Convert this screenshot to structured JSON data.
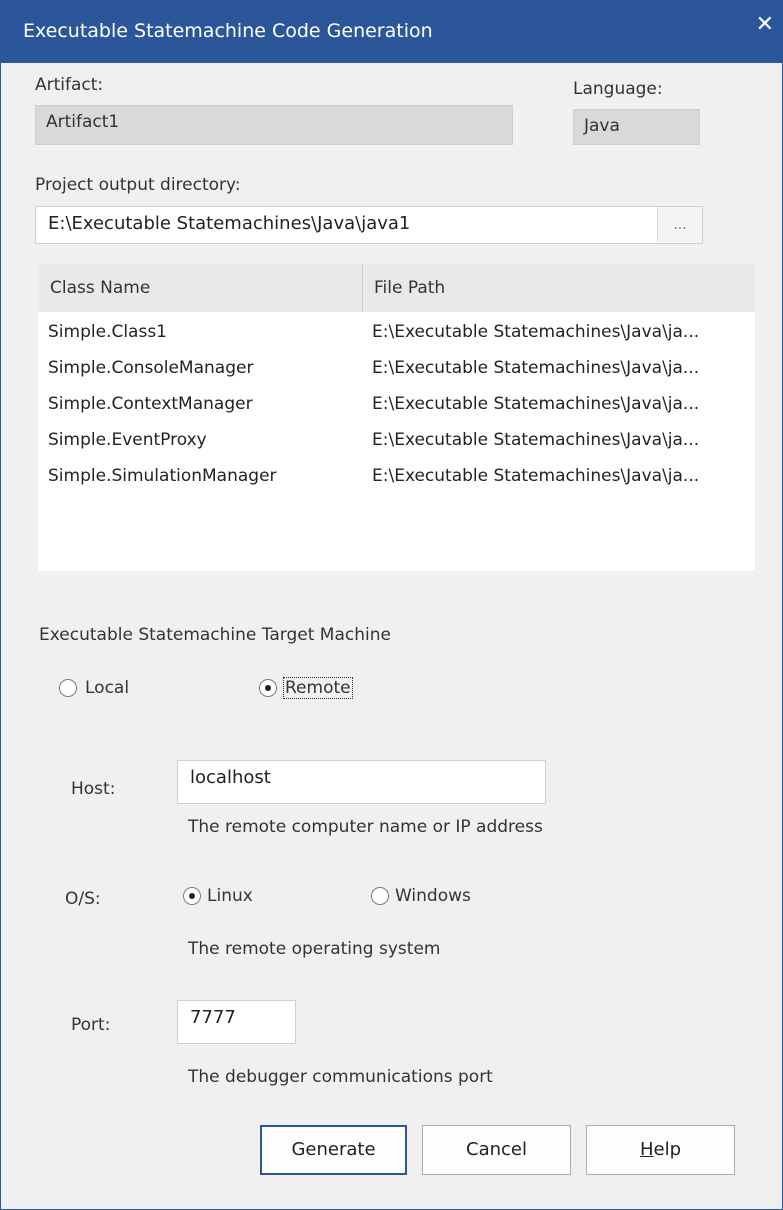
{
  "window": {
    "title": "Executable Statemachine Code Generation"
  },
  "artifact": {
    "label": "Artifact:",
    "value": "Artifact1"
  },
  "language": {
    "label": "Language:",
    "value": "Java"
  },
  "output": {
    "label": "Project output directory:",
    "value": "E:\\Executable Statemachines\\Java\\java1",
    "browse_label": "..."
  },
  "table": {
    "headers": [
      "Class Name",
      "File Path"
    ],
    "rows": [
      [
        "Simple.Class1",
        "E:\\Executable Statemachines\\Java\\ja..."
      ],
      [
        "Simple.ConsoleManager",
        "E:\\Executable Statemachines\\Java\\ja..."
      ],
      [
        "Simple.ContextManager",
        "E:\\Executable Statemachines\\Java\\ja..."
      ],
      [
        "Simple.EventProxy",
        "E:\\Executable Statemachines\\Java\\ja..."
      ],
      [
        "Simple.SimulationManager",
        "E:\\Executable Statemachines\\Java\\ja..."
      ]
    ]
  },
  "target": {
    "heading": "Executable Statemachine Target Machine",
    "local_label": "Local",
    "remote_label": "Remote",
    "selected": "Remote"
  },
  "host": {
    "label": "Host:",
    "value": "localhost",
    "hint": "The remote computer name or IP address"
  },
  "os": {
    "label": "O/S:",
    "linux_label": "Linux",
    "windows_label": "Windows",
    "selected": "Linux",
    "hint": "The remote operating system"
  },
  "port": {
    "label": "Port:",
    "value": "7777",
    "hint": "The debugger communications port"
  },
  "buttons": {
    "generate": "Generate",
    "cancel": "Cancel",
    "help": "Help"
  }
}
